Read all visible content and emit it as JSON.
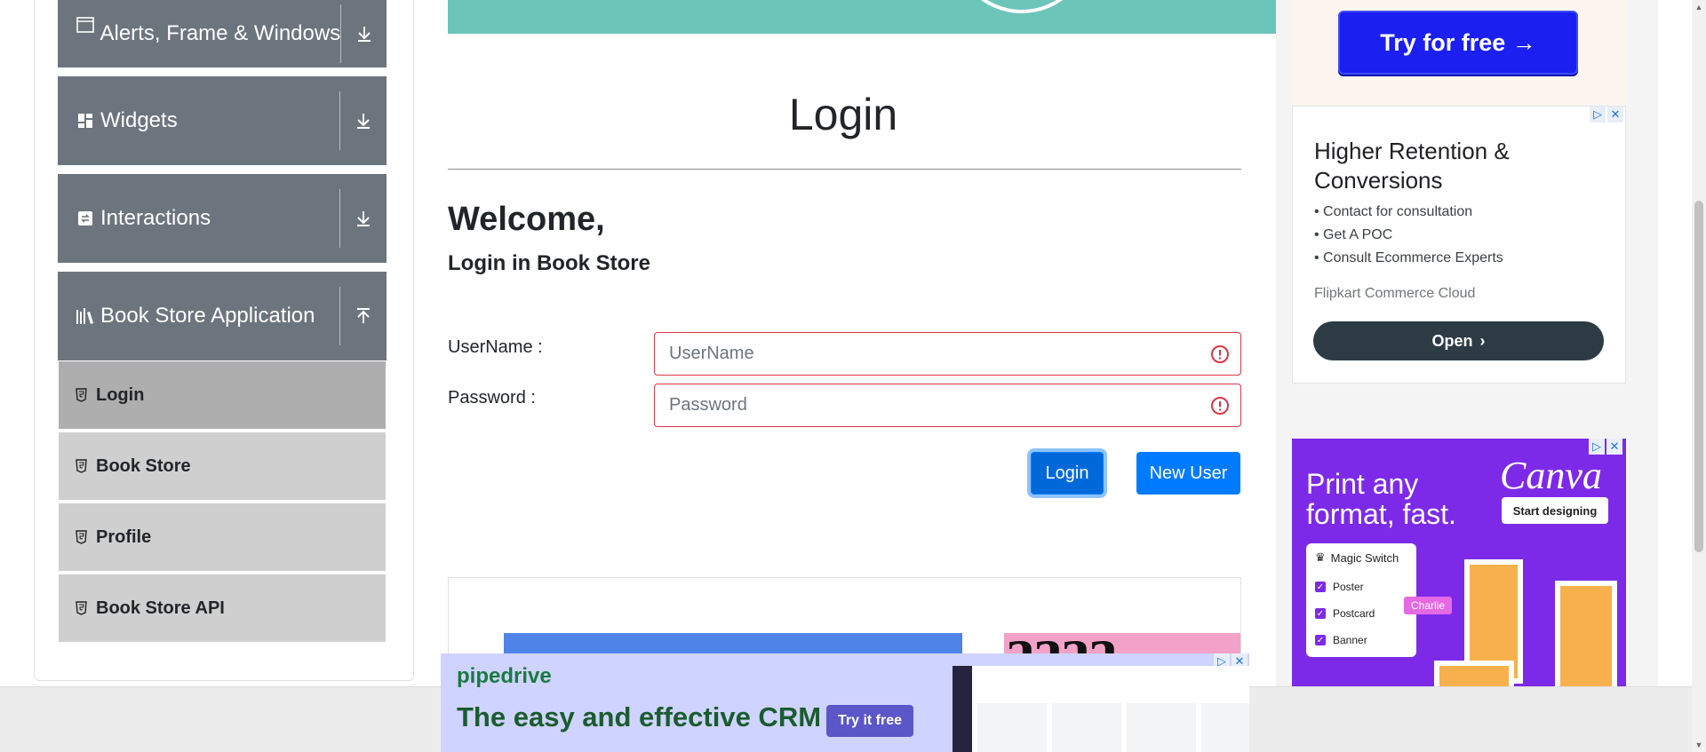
{
  "sidebar": {
    "groups": [
      {
        "label": "Alerts, Frame & Windows",
        "icon": "window-icon"
      },
      {
        "label": "Widgets",
        "icon": "widgets-icon"
      },
      {
        "label": "Interactions",
        "icon": "interactions-icon"
      },
      {
        "label": "Book Store Application",
        "icon": "library-icon"
      }
    ],
    "items": [
      {
        "label": "Login",
        "active": true
      },
      {
        "label": "Book Store"
      },
      {
        "label": "Profile"
      },
      {
        "label": "Book Store API"
      }
    ]
  },
  "main": {
    "title": "Login",
    "welcome": "Welcome,",
    "subheading": "Login in Book Store",
    "username_label": "UserName :",
    "username_placeholder": "UserName",
    "password_label": "Password :",
    "password_placeholder": "Password",
    "login_button": "Login",
    "new_user_button": "New User"
  },
  "ads": {
    "try_free": "Try for free →",
    "retention": {
      "headline": "Higher Retention & Conversions",
      "bullets": [
        "Contact for consultation",
        "Get A POC",
        "Consult Ecommerce Experts"
      ],
      "brand": "Flipkart Commerce Cloud",
      "cta": "Open"
    },
    "canva": {
      "headline": "Print any format, fast.",
      "logo": "Canva",
      "cta": "Start designing",
      "panel_title": "Magic Switch",
      "options": [
        "Poster",
        "Postcard",
        "Banner"
      ],
      "cursor_tag": "Charlie"
    },
    "pipedrive": {
      "brand": "pipedrive",
      "tagline": "The easy and effective CRM",
      "cta": "Try it free"
    }
  },
  "colors": {
    "sidebar_group": "#6c757d",
    "menu_item": "#cfcfcf",
    "menu_item_active": "#aeaeae",
    "primary": "#007bff",
    "invalid": "#dc3545",
    "banner": "#6cc5b9"
  }
}
